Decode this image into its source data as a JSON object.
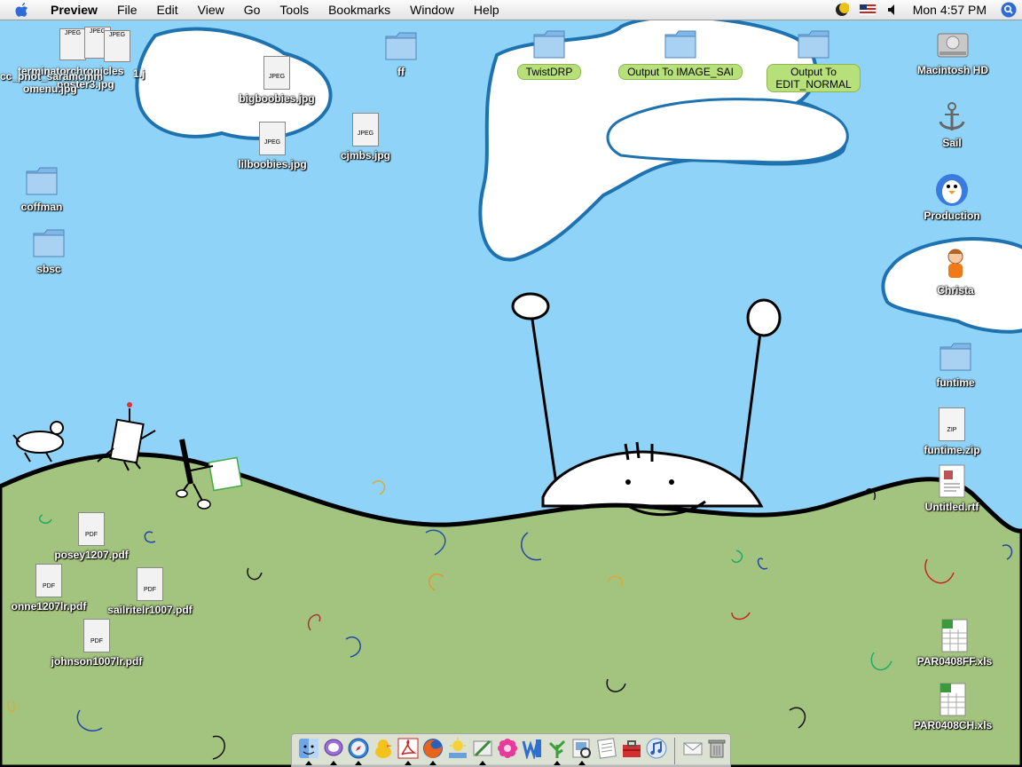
{
  "menubar": {
    "app_name": "Preview",
    "menus": [
      "File",
      "Edit",
      "View",
      "Go",
      "Tools",
      "Bookmarks",
      "Window",
      "Help"
    ],
    "clock": "Mon 4:57 PM",
    "icons": [
      "apple-icon",
      "moon-status-icon",
      "flag-input-icon",
      "volume-icon",
      "spotlight-icon"
    ]
  },
  "desktop_icons": {
    "jpeg_stack_1": "cc_pnot_saramcmm",
    "jpeg_stack_2": "terminatorchronicles",
    "jpeg_stack_3": "omenu.jpg",
    "jpeg_stack_4": "poster3.jpg",
    "jpeg_stack_5": "1.j",
    "bigboobies": "bigboobies.jpg",
    "lilboobies": "lilboobies.jpg",
    "cjmbs": "cjmbs.jpg",
    "ff": "ff",
    "twistdrp": "TwistDRP",
    "output_image_sai": "Output To IMAGE_SAI",
    "output_edit_normal": "Output To\nEDIT_NORMAL",
    "macintosh_hd": "Macintosh HD",
    "sail": "Sail",
    "production": "Production",
    "christa": "Christa",
    "coffman": "coffman",
    "sbsc": "sbsc",
    "funtime": "funtime",
    "funtime_zip": "funtime.zip",
    "untitled_rtf": "Untitled.rtf",
    "posey": "posey1207.pdf",
    "onne": "onne1207lr.pdf",
    "sailrite": "sailritelr1007.pdf",
    "johnson": "johnson1007lr.pdf",
    "par0408ff": "PAR0408FF.xls",
    "par0408ch": "PAR0408CH.xls"
  },
  "file_badges": {
    "jpeg": "JPEG",
    "pdf": "PDF",
    "zip": "ZIP",
    "xls": "X"
  },
  "dock": {
    "items": [
      "finder-icon",
      "ichat-icon",
      "safari-icon",
      "adium-icon",
      "acrobat-icon",
      "firefox-icon",
      "iphoto-icon",
      "pencil-app-icon",
      "flower-app-icon",
      "word-icon",
      "twig-app-icon",
      "preview-icon",
      "textedit-icon",
      "toolbox-icon",
      "itunes-icon",
      "mail-icon",
      "trash-icon"
    ]
  },
  "colors": {
    "sky": "#8fd4f8",
    "hill": "#a3c47e",
    "cloud_outline": "#1f72b0",
    "tag_green": "#b8e07a",
    "folder_blue": "#7fb7e6"
  }
}
